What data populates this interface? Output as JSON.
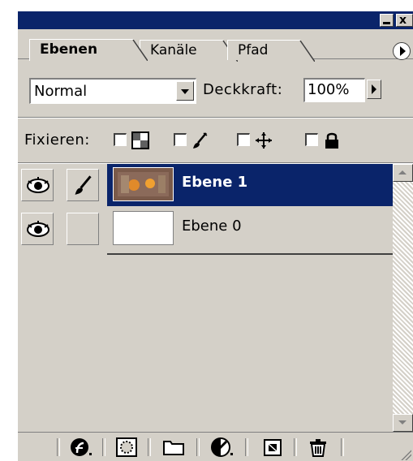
{
  "palette": {
    "tabs": [
      {
        "label": "Ebenen",
        "active": true
      },
      {
        "label": "Kanäle",
        "active": false
      },
      {
        "label": "Pfad",
        "active": false
      }
    ],
    "close_label": "x"
  },
  "blend": {
    "mode": "Normal",
    "opacity_label": "Deckkraft:",
    "opacity_value": "100%"
  },
  "lock": {
    "label": "Fixieren:",
    "options": [
      "transparency-lock",
      "paint-lock",
      "move-lock",
      "all-lock"
    ]
  },
  "layers": [
    {
      "name": "Ebene 1",
      "selected": true,
      "visible": true,
      "link_icon": "brush-icon"
    },
    {
      "name": "Ebene 0",
      "selected": false,
      "visible": true,
      "link_icon": ""
    }
  ],
  "toolbar": {
    "buttons": [
      "layer-style-icon",
      "mask-icon",
      "layer-set-icon",
      "adjustment-layer-icon",
      "new-layer-icon",
      "trash-icon"
    ]
  },
  "colors": {
    "panel": "#d4d0c8",
    "selection": "#0a246a",
    "titlebar": "#0a246a"
  }
}
